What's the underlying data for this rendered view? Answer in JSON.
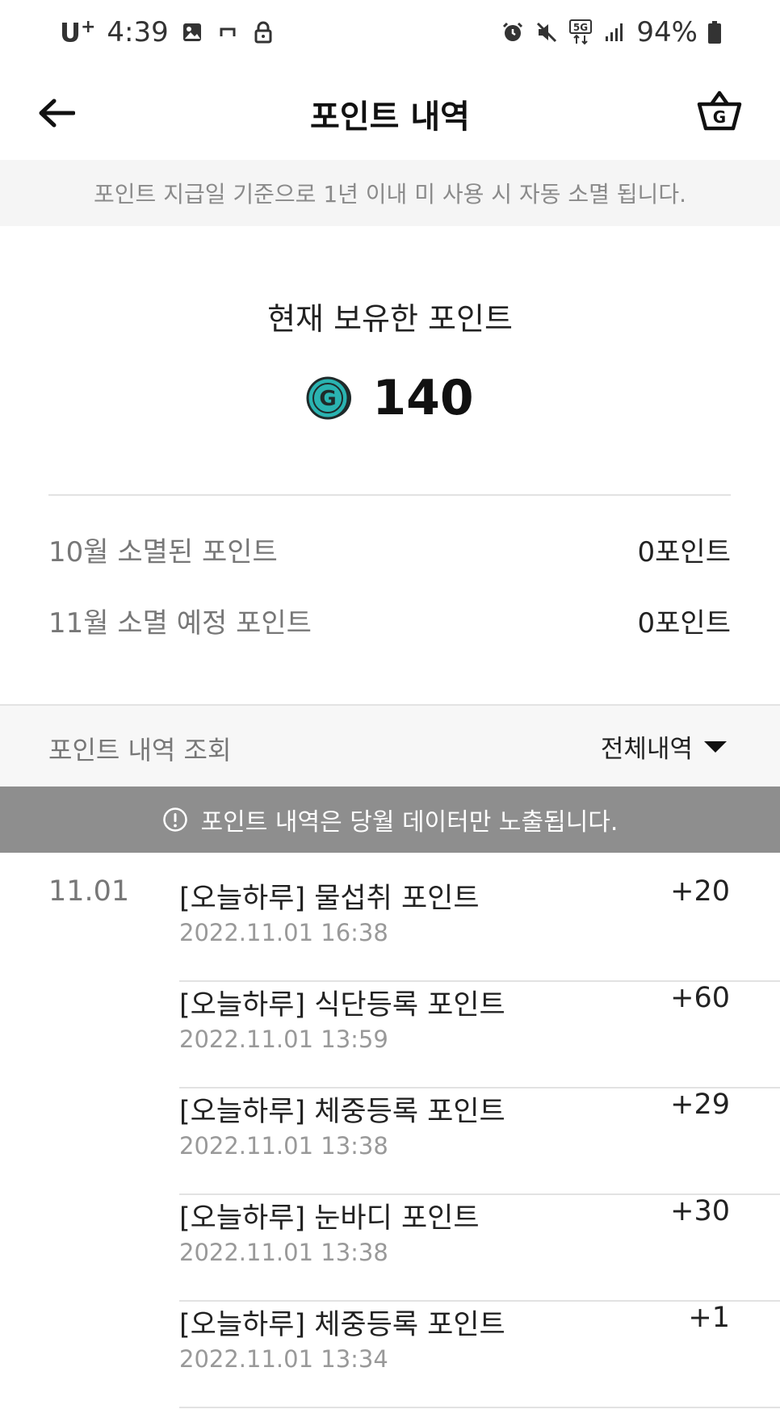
{
  "status_bar": {
    "carrier": "U",
    "carrier_plus": "+",
    "time": "4:39",
    "battery": "94%"
  },
  "header": {
    "title": "포인트 내역"
  },
  "notice": "포인트 지급일 기준으로 1년 이내 미 사용 시 자동 소멸 됩니다.",
  "balance": {
    "label": "현재 보유한 포인트",
    "value": "140"
  },
  "expiry": [
    {
      "label": "10월 소멸된 포인트",
      "value": "0포인트"
    },
    {
      "label": "11월 소멸 예정 포인트",
      "value": "0포인트"
    }
  ],
  "history": {
    "label": "포인트 내역 조회",
    "filter": "전체내역",
    "info": "포인트 내역은 당월 데이터만 노출됩니다.",
    "date": "11.01",
    "items": [
      {
        "title": "[오늘하루]  물섭취 포인트",
        "time": "2022.11.01 16:38",
        "amount": "+20"
      },
      {
        "title": "[오늘하루]  식단등록 포인트",
        "time": "2022.11.01 13:59",
        "amount": "+60"
      },
      {
        "title": "[오늘하루]  체중등록 포인트",
        "time": "2022.11.01 13:38",
        "amount": "+29"
      },
      {
        "title": "[오늘하루]  눈바디 포인트",
        "time": "2022.11.01 13:38",
        "amount": "+30"
      },
      {
        "title": "[오늘하루]  체중등록 포인트",
        "time": "2022.11.01 13:34",
        "amount": "+1"
      }
    ]
  },
  "colors": {
    "coin": "#2ab3b1",
    "info_bar": "#8e8e8e",
    "notice_bg": "#f5f5f5"
  },
  "icons": [
    "back-arrow-icon",
    "g-basket-icon",
    "g-coin-icon",
    "info-circle-icon",
    "caret-down-icon"
  ]
}
